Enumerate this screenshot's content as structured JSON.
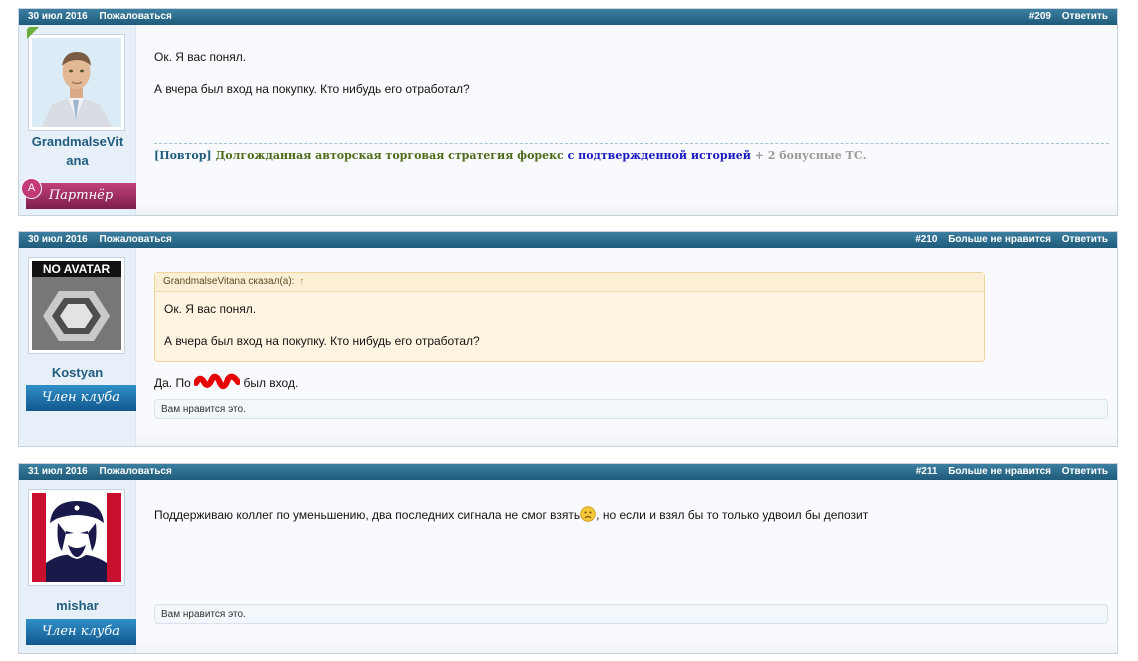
{
  "posts": [
    {
      "date": "30 июл 2016",
      "report": "Пожаловаться",
      "number": "#209",
      "actions": [
        "Ответить"
      ],
      "user": {
        "name": "GrandmalseVitana",
        "name_line1": "GrandmalseVit",
        "name_line2": "ana",
        "badge": "Партнёр",
        "badge_letter": "A"
      },
      "message": [
        "Ок. Я вас понял.",
        "А вчера был вход на покупку. Кто нибудь его отработал?"
      ],
      "signature": {
        "part1": "[Повтор]",
        "part2": "Долгожданная авторская торговая стратегия форекс",
        "part3": "с подтвержденной историей",
        "part4": "+ 2 бонусные ТС."
      }
    },
    {
      "date": "30 июл 2016",
      "report": "Пожаловаться",
      "number": "#210",
      "actions": [
        "Больше не нравится",
        "Ответить"
      ],
      "user": {
        "name": "Kostyan",
        "badge": "Член клуба",
        "avatar_text": "NO AVATAR"
      },
      "quote": {
        "author": "GrandmalseVitana сказал(а):",
        "arrow": "↑",
        "lines": [
          "Ок. Я вас понял.",
          "А вчера был вход на покупку. Кто нибудь его отработал?"
        ]
      },
      "message_before": "Да. По",
      "message_after": "был вход.",
      "likes": "Вам нравится это."
    },
    {
      "date": "31 июл 2016",
      "report": "Пожаловаться",
      "number": "#211",
      "actions": [
        "Больше не нравится",
        "Ответить"
      ],
      "user": {
        "name": "mishar",
        "badge": "Член клуба"
      },
      "message_before": "Поддерживаю коллег по уменьшению, два последних сигнала не смог взять",
      "message_after": ", но если и взял бы то только удвоил бы депозит",
      "likes": "Вам нравится это."
    }
  ],
  "colors": {
    "bar": "#2c6d8f",
    "username": "#205c7e",
    "partner_badge": "#9c2a62",
    "member_badge": "#1b6da6"
  }
}
